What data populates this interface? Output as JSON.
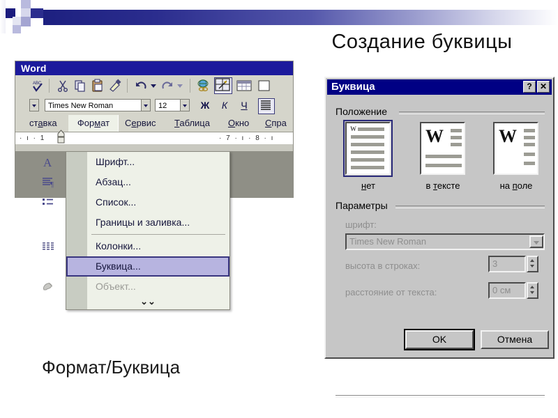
{
  "slide": {
    "title": "Создание  буквицы",
    "caption": "Формат/Буквица"
  },
  "word_window": {
    "title": "Word",
    "toolbar_icons": [
      "spelling-icon",
      "cut-icon",
      "copy-icon",
      "paste-icon",
      "format-painter-icon",
      "undo-icon",
      "undo-dropdown-icon",
      "redo-icon",
      "redo-dropdown-icon",
      "hyperlink-icon",
      "tables-and-borders-icon",
      "insert-table-icon"
    ],
    "font_name": "Times New Roman",
    "font_size": "12",
    "bold_label": "Ж",
    "italic_label": "К",
    "underline_label": "Ч",
    "menubar": [
      {
        "label": "ставка",
        "accel": "а"
      },
      {
        "label": "Формат",
        "accel": "м"
      },
      {
        "label": "Сервис",
        "accel": "е"
      },
      {
        "label": "Таблица",
        "accel": "Т"
      },
      {
        "label": "Окно",
        "accel": "О"
      },
      {
        "label": "Спра",
        "accel": "С"
      }
    ],
    "ruler_left": "·  ı  ·  1",
    "ruler_right": "·  7  ·  ı  ·  8  ·  ı"
  },
  "format_menu": {
    "items": [
      {
        "label": "Шрифт...",
        "icon": "font-letter-a-icon",
        "state": "normal"
      },
      {
        "label": "Абзац...",
        "icon": "paragraph-icon",
        "state": "normal"
      },
      {
        "label": "Список...",
        "icon": "bulleted-list-icon",
        "state": "normal"
      },
      {
        "label": "Границы и заливка...",
        "icon": "borders-and-shading-icon",
        "state": "normal"
      },
      {
        "label": "Колонки...",
        "icon": "columns-icon",
        "state": "normal"
      },
      {
        "label": "Буквица...",
        "icon": "drop-cap-icon",
        "state": "selected"
      },
      {
        "label": "Объект...",
        "icon": "object-icon",
        "state": "disabled"
      }
    ],
    "expand_glyph": "⌄⌄"
  },
  "dialog": {
    "title": "Буквица",
    "help_button": "?",
    "close_button": "✕",
    "position_group_label": "Положение",
    "position_options": [
      {
        "label": "нет",
        "accel": "н",
        "selected": true
      },
      {
        "label": "в тексте",
        "accel": "т",
        "selected": false
      },
      {
        "label": "на поле",
        "accel": "п",
        "selected": false
      }
    ],
    "preview_letter": "W",
    "params_group_label": "Параметры",
    "params": [
      {
        "label": "шрифт:",
        "value": "Times New Roman",
        "control": "combobox"
      },
      {
        "label": "высота в строках:",
        "value": "3",
        "control": "spinner"
      },
      {
        "label": "расстояние от текста:",
        "value": "0 см",
        "control": "spinner"
      }
    ],
    "ok_label": "OK",
    "cancel_label": "Отмена"
  },
  "colors": {
    "banner_start": "#1d2080",
    "title_bar_blue": "#000084",
    "word_title_blue": "#1c1a9c",
    "menu_selected": "#b7b4e0",
    "dialog_face": "#c6c6c6"
  }
}
